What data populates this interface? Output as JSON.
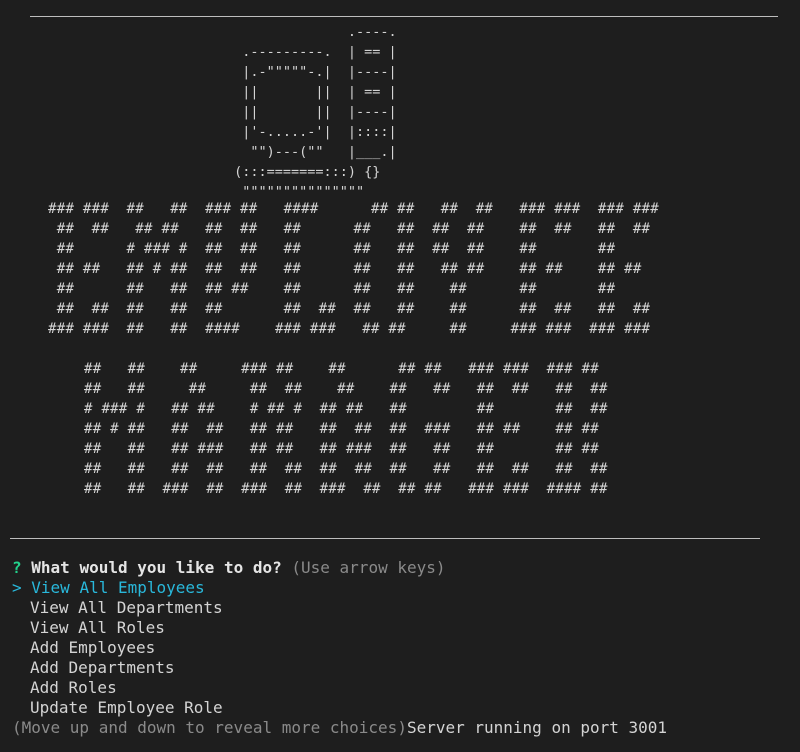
{
  "ascii_art": {
    "computer": "               .----.\n  .---------.  | == |\n  |.-\"\"\"\"\"-.|  |----|\n  ||       ||  | == |\n  ||       ||  |----|\n  |'-.....-'|  |::::|\n   \"\")---(\"\"   |___.|\n (:::=======:::) {}\n  \"\"\"\"\"\"\"\"\"\"\"\"\"\"\"",
    "banner_line1": "### ###  ##   ##  ### ##   ####      ## ##   ##  ##   ### ###  ### ###\n ##  ##   ## ##   ##  ##   ##      ##   ##  ##  ##    ##  ##   ##  ##\n ##      # ### #  ##  ##   ##      ##   ##  ##  ##    ##       ##\n ## ##   ## # ##  ##  ##   ##      ##   ##   ## ##    ## ##    ## ##\n ##      ##   ##  ## ##    ##      ##   ##    ##      ##       ##\n ##  ##  ##   ##  ##       ##  ##  ##   ##    ##      ##  ##   ##  ##\n### ###  ##   ##  ####    ### ###   ## ##     ##     ### ###  ### ###",
    "banner_line2": "##   ##    ##     ### ##    ##      ## ##   ### ###  ### ##\n##   ##     ##     ##  ##    ##    ##   ##   ##  ##   ##  ##\n# ### #   ## ##    # ## #  ## ##   ##        ##       ##  ##\n## # ##   ##  ##   ## ##   ##  ##  ##  ###   ## ##    ## ##\n##   ##   ## ###   ## ##   ## ###  ##   ##   ##       ## ##\n##   ##   ##  ##   ##  ##  ##  ##  ##   ##   ##  ##   ##  ##\n##   ##  ###  ##  ###  ##  ###  ##  ## ##   ### ###  #### ##"
  },
  "prompt": {
    "marker": "?",
    "question": "What would you like to do?",
    "hint": "(Use arrow keys)",
    "caret": ">",
    "choices": [
      "View All Employees",
      "View All Departments",
      "View All Roles",
      "Add Employees",
      "Add Departments",
      "Add Roles",
      "Update Employee Role"
    ],
    "footer_hint": "(Move up and down to reveal more choices)",
    "server_message": "Server running on port 3001"
  },
  "colors": {
    "background": "#1e1e1e",
    "selected": "#29b8db",
    "question_mark": "#23d18b",
    "hint": "#8a8a8a"
  }
}
